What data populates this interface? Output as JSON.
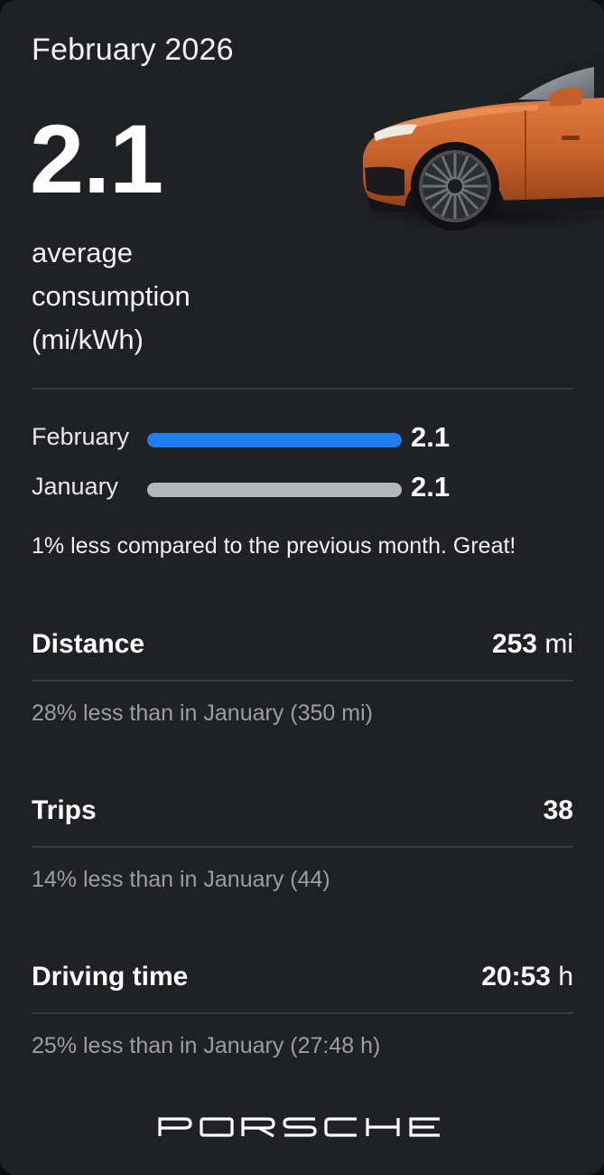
{
  "header": {
    "month": "February 2026"
  },
  "consumption": {
    "value": "2.1",
    "caption_lines": [
      "average",
      "consumption",
      "(mi/kWh)"
    ]
  },
  "comparison": {
    "rows": [
      {
        "label": "February",
        "value": "2.1",
        "bar_color": "#1f7cf2"
      },
      {
        "label": "January",
        "value": "2.1",
        "bar_color": "#b6b7bb"
      }
    ],
    "note": "1% less compared to the previous month. Great!"
  },
  "stats": [
    {
      "label": "Distance",
      "value": "253",
      "unit": "mi",
      "note": "28% less than in January (350 mi)"
    },
    {
      "label": "Trips",
      "value": "38",
      "unit": "",
      "note": "14% less than in January (44)"
    },
    {
      "label": "Driving time",
      "value": "20:53",
      "unit": "h",
      "note": "25% less than in January (27:48 h)"
    }
  ],
  "brand": {
    "logo_text": "PORSCHE"
  },
  "car_image": {
    "icon": "car-illustration",
    "color": "#c8642e"
  }
}
